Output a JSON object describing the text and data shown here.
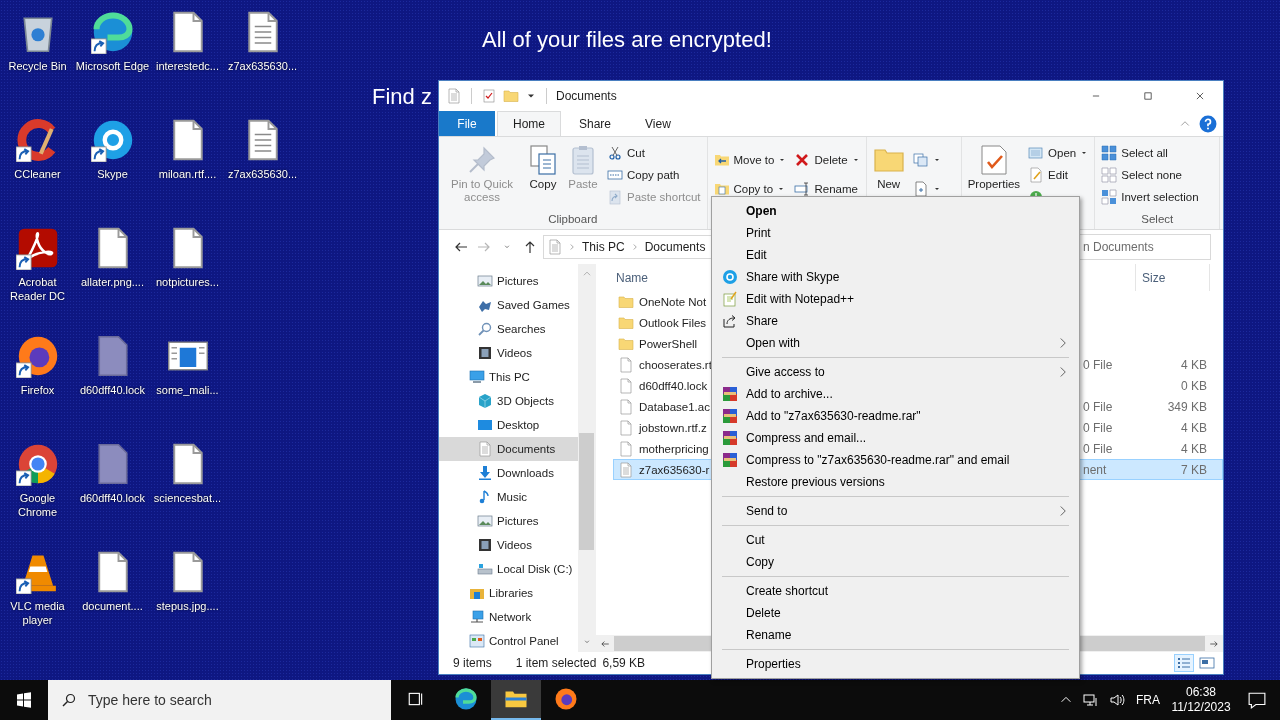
{
  "desktop": {
    "message_lines": [
      "All of your files are encrypted!",
      "Find z"
    ],
    "icons": [
      {
        "label": "Recycle Bin",
        "kind": "recycle",
        "shortcut": false
      },
      {
        "label": "CCleaner",
        "kind": "ccleaner",
        "shortcut": true
      },
      {
        "label": "Acrobat Reader DC",
        "kind": "acrobat",
        "shortcut": true
      },
      {
        "label": "Firefox",
        "kind": "firefox",
        "shortcut": true
      },
      {
        "label": "Google Chrome",
        "kind": "chrome",
        "shortcut": true
      },
      {
        "label": "VLC media player",
        "kind": "vlc",
        "shortcut": true
      },
      {
        "label": "Microsoft Edge",
        "kind": "edge",
        "shortcut": true
      },
      {
        "label": "Skype",
        "kind": "skype",
        "shortcut": true
      },
      {
        "label": "allater.png....",
        "kind": "doc",
        "shortcut": false
      },
      {
        "label": "d60dff40.lock",
        "kind": "lock",
        "shortcut": false
      },
      {
        "label": "d60dff40.lock",
        "kind": "lock",
        "shortcut": false
      },
      {
        "label": "document....",
        "kind": "doc",
        "shortcut": false
      },
      {
        "label": "interestedc...",
        "kind": "doc",
        "shortcut": false
      },
      {
        "label": "miloan.rtf....",
        "kind": "doc",
        "shortcut": false
      },
      {
        "label": "notpictures...",
        "kind": "doc",
        "shortcut": false
      },
      {
        "label": "some_mali...",
        "kind": "image",
        "shortcut": false
      },
      {
        "label": "sciencesbat...",
        "kind": "doc",
        "shortcut": false
      },
      {
        "label": "stepus.jpg....",
        "kind": "doc",
        "shortcut": false
      },
      {
        "label": "z7ax635630...",
        "kind": "lines",
        "shortcut": false
      },
      {
        "label": "z7ax635630...",
        "kind": "lines",
        "shortcut": false
      }
    ]
  },
  "explorer": {
    "title": "Documents",
    "tabs": [
      {
        "label": "File",
        "kind": "menu",
        "selected": false
      },
      {
        "label": "Home",
        "kind": "tab",
        "selected": true
      },
      {
        "label": "Share",
        "kind": "tab",
        "selected": false
      },
      {
        "label": "View",
        "kind": "tab",
        "selected": false
      }
    ],
    "ribbon": {
      "groups": [
        {
          "label": "Clipboard",
          "columns": [
            {
              "kind": "large",
              "buttons": [
                {
                  "label": "Pin to Quick access",
                  "kind": "pin",
                  "disabled": true,
                  "dropdown": false
                }
              ]
            },
            {
              "kind": "large",
              "buttons": [
                {
                  "label": "Copy",
                  "kind": "copy",
                  "disabled": false,
                  "dropdown": false
                }
              ]
            },
            {
              "kind": "large",
              "buttons": [
                {
                  "label": "Paste",
                  "kind": "paste",
                  "disabled": true,
                  "dropdown": false
                }
              ]
            },
            {
              "kind": "small",
              "buttons": [
                {
                  "label": "Cut",
                  "kind": "cut",
                  "disabled": false,
                  "dropdown": false
                },
                {
                  "label": "Copy path",
                  "kind": "copypath",
                  "disabled": false,
                  "dropdown": false
                },
                {
                  "label": "Paste shortcut",
                  "kind": "pasteshortcut",
                  "disabled": true,
                  "dropdown": false
                }
              ]
            }
          ]
        },
        {
          "columns": [
            {
              "kind": "small",
              "buttons": [
                {
                  "label": "Move to",
                  "kind": "moveto",
                  "disabled": false,
                  "dropdown": true
                },
                {
                  "label": "Copy to",
                  "kind": "copyto",
                  "disabled": false,
                  "dropdown": true
                }
              ]
            },
            {
              "kind": "small",
              "buttons": [
                {
                  "label": "Delete",
                  "kind": "delete",
                  "disabled": false,
                  "dropdown": true
                },
                {
                  "label": "Rename",
                  "kind": "rename",
                  "disabled": false,
                  "dropdown": false
                }
              ]
            }
          ]
        },
        {
          "columns": [
            {
              "kind": "large",
              "buttons": [
                {
                  "label": "New",
                  "kind": "newfolder",
                  "disabled": false,
                  "dropdown": false
                }
              ]
            },
            {
              "kind": "small",
              "buttons": [
                {
                  "kind": "newitem",
                  "disabled": false,
                  "dropdown": true
                },
                {
                  "kind": "easyaccess",
                  "disabled": false,
                  "dropdown": true
                }
              ]
            }
          ]
        },
        {
          "columns": [
            {
              "kind": "large",
              "buttons": [
                {
                  "label": "Properties",
                  "kind": "properties",
                  "disabled": false,
                  "dropdown": false
                }
              ]
            },
            {
              "kind": "small",
              "buttons": [
                {
                  "label": "Open",
                  "kind": "open",
                  "disabled": false,
                  "dropdown": true
                },
                {
                  "label": "Edit",
                  "kind": "edit",
                  "disabled": false,
                  "dropdown": false
                },
                {
                  "kind": "history",
                  "disabled": false,
                  "dropdown": false
                }
              ]
            }
          ]
        },
        {
          "label": "Select",
          "columns": [
            {
              "kind": "small",
              "buttons": [
                {
                  "label": "Select all",
                  "kind": "selectall",
                  "disabled": false,
                  "dropdown": false
                },
                {
                  "label": "Select none",
                  "kind": "selectnone",
                  "disabled": false,
                  "dropdown": false
                },
                {
                  "label": "Invert selection",
                  "kind": "invert",
                  "disabled": false,
                  "dropdown": false
                }
              ]
            }
          ]
        }
      ]
    },
    "address": {
      "nav_buttons": [
        {
          "kind": "back",
          "disabled": false
        },
        {
          "kind": "forward",
          "disabled": true
        },
        {
          "kind": "recent",
          "disabled": false
        },
        {
          "kind": "up",
          "disabled": false
        }
      ],
      "path": [
        "This PC",
        "Documents"
      ],
      "search_placeholder": "n Documents"
    },
    "nav_pane": {
      "items": [
        {
          "children": [
            {
              "label": "Pictures",
              "kind": "pictures",
              "selected": false
            },
            {
              "label": "Saved Games",
              "kind": "games",
              "selected": false
            },
            {
              "label": "Searches",
              "kind": "search",
              "selected": false
            },
            {
              "label": "Videos",
              "kind": "videos",
              "selected": false
            }
          ]
        },
        {
          "label": "This PC",
          "kind": "pc",
          "selected": false,
          "children": [
            {
              "label": "3D Objects",
              "kind": "objects3d",
              "selected": false
            },
            {
              "label": "Desktop",
              "kind": "desktop",
              "selected": false
            },
            {
              "label": "Documents",
              "kind": "documents",
              "selected": true
            },
            {
              "label": "Downloads",
              "kind": "downloads",
              "selected": false
            },
            {
              "label": "Music",
              "kind": "music",
              "selected": false
            },
            {
              "label": "Pictures",
              "kind": "pictures",
              "selected": false
            },
            {
              "label": "Videos",
              "kind": "videos",
              "selected": false
            },
            {
              "label": "Local Disk (C:)",
              "kind": "disk",
              "selected": false
            }
          ]
        },
        {
          "label": "Libraries",
          "kind": "libraries",
          "selected": false
        },
        {
          "label": "Network",
          "kind": "network",
          "selected": false
        },
        {
          "label": "Control Panel",
          "kind": "control",
          "selected": false
        }
      ]
    },
    "column_headers": [
      "Name",
      "Size"
    ],
    "files": [
      {
        "name": "OneNote Not",
        "kind": "folder",
        "selected": false
      },
      {
        "name": "Outlook Files",
        "kind": "folder",
        "selected": false
      },
      {
        "name": "PowerShell",
        "kind": "folder",
        "selected": false
      },
      {
        "name": "chooserates.rt",
        "kind": "doc",
        "type": "0 File",
        "size": "4 KB",
        "selected": false
      },
      {
        "name": "d60dff40.lock",
        "kind": "doc",
        "size": "0 KB",
        "selected": false
      },
      {
        "name": "Database1.ac",
        "kind": "doc",
        "type": "0 File",
        "size": "349 KB",
        "selected": false
      },
      {
        "name": "jobstown.rtf.z",
        "kind": "doc",
        "type": "0 File",
        "size": "4 KB",
        "selected": false
      },
      {
        "name": "motherpricing",
        "kind": "doc",
        "type": "0 File",
        "size": "4 KB",
        "selected": false
      },
      {
        "name": "z7ax635630-r",
        "kind": "lines",
        "type": "nent",
        "size": "7 KB",
        "selected": true
      }
    ],
    "status_bar": {
      "item_count": "9 items",
      "selection": "1 item selected",
      "selection_size": "6,59 KB",
      "views": [
        {
          "kind": "details",
          "selected": true
        },
        {
          "kind": "large",
          "selected": false
        }
      ]
    }
  },
  "context_menu": {
    "items": [
      {
        "label": "Open",
        "kind": "plain",
        "default": true,
        "submenu": false
      },
      {
        "label": "Print",
        "kind": "plain",
        "default": false,
        "submenu": false
      },
      {
        "label": "Edit",
        "kind": "plain",
        "default": false,
        "submenu": false
      },
      {
        "label": "Share with Skype",
        "kind": "skype",
        "default": false,
        "submenu": false
      },
      {
        "label": "Edit with Notepad++",
        "kind": "notepad",
        "default": false,
        "submenu": false
      },
      {
        "label": "Share",
        "kind": "share",
        "default": false,
        "submenu": false
      },
      {
        "label": "Open with",
        "kind": "plain",
        "default": false,
        "submenu": true
      },
      {
        "kind": "separator"
      },
      {
        "label": "Give access to",
        "kind": "plain",
        "default": false,
        "submenu": true
      },
      {
        "label": "Add to archive...",
        "kind": "archive",
        "default": false,
        "submenu": false
      },
      {
        "label": "Add to \"z7ax635630-readme.rar\"",
        "kind": "archive",
        "default": false,
        "submenu": false
      },
      {
        "label": "Compress and email...",
        "kind": "archive",
        "default": false,
        "submenu": false
      },
      {
        "label": "Compress to \"z7ax635630-readme.rar\" and email",
        "kind": "archive",
        "default": false,
        "submenu": false
      },
      {
        "label": "Restore previous versions",
        "kind": "plain",
        "default": false,
        "submenu": false
      },
      {
        "kind": "separator"
      },
      {
        "label": "Send to",
        "kind": "plain",
        "default": false,
        "submenu": true
      },
      {
        "kind": "separator"
      },
      {
        "label": "Cut",
        "kind": "plain",
        "default": false,
        "submenu": false
      },
      {
        "label": "Copy",
        "kind": "plain",
        "default": false,
        "submenu": false
      },
      {
        "kind": "separator"
      },
      {
        "label": "Create shortcut",
        "kind": "plain",
        "default": false,
        "submenu": false
      },
      {
        "label": "Delete",
        "kind": "plain",
        "default": false,
        "submenu": false
      },
      {
        "label": "Rename",
        "kind": "plain",
        "default": false,
        "submenu": false
      },
      {
        "kind": "separator"
      },
      {
        "label": "Properties",
        "kind": "plain",
        "default": false,
        "submenu": false
      }
    ]
  },
  "taskbar": {
    "search_placeholder": "Type here to search",
    "apps": [
      {
        "kind": "taskview",
        "active": false
      },
      {
        "kind": "edge",
        "active": false
      },
      {
        "kind": "explorer",
        "active": true
      },
      {
        "kind": "firefox",
        "active": false
      }
    ],
    "language": "FRA",
    "time": "06:38",
    "date": "11/12/2023"
  }
}
